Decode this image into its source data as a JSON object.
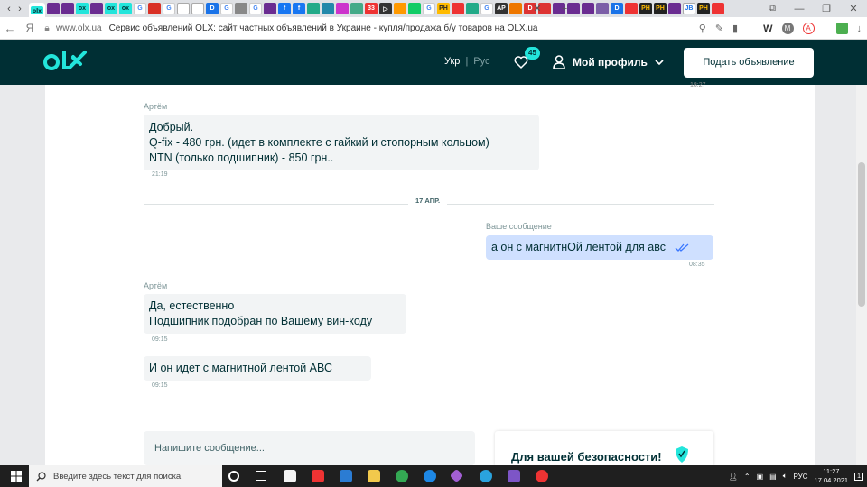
{
  "browser": {
    "url_host": "www.olx.ua",
    "page_title": "Сервис объявлений OLX: сайт частных объявлений в Украине - купля/продажа б/у товаров на OLX.ua",
    "yandex_letter": "Я"
  },
  "header": {
    "lang_ukr": "Укр",
    "lang_sep": "|",
    "lang_rus": "Рус",
    "favorites_count": "45",
    "profile_label": "Мой профиль",
    "post_button": "Подать объявление"
  },
  "chat": {
    "top_time": "18:27",
    "messages": [
      {
        "sender": "Артём",
        "lines": [
          "Добрый.",
          "Q-fix - 480 грн. (идет в комплекте с гайкий и стопорным кольцом)",
          "NTN (только подшипник) - 850 грн.."
        ],
        "time": "21:19"
      },
      {
        "sender": "Ваше сообщение",
        "lines": [
          "а он с магнитнОй лентой для авс"
        ],
        "time": "08:35"
      },
      {
        "sender": "Артём",
        "lines": [
          "Да, естественно",
          "Подшипник подобран по Вашему вин-коду"
        ],
        "time": "09:15"
      },
      {
        "lines": [
          "И он идет с магнитной лентой АВС"
        ],
        "time": "09:15"
      }
    ],
    "date_divider": "17 АПР.",
    "input_placeholder": "Напишите сообщение...",
    "safety_title": "Для вашей безопасности!"
  },
  "taskbar": {
    "search_placeholder": "Введите здесь текст для поиска",
    "lang": "РУС",
    "time": "11:27",
    "date": "17.04.2021",
    "notifications": "1"
  },
  "colors": {
    "olx_dark": "#002f34",
    "olx_teal": "#23e5db",
    "bubble_in": "#f2f4f5",
    "bubble_out": "#cfe0ff"
  }
}
